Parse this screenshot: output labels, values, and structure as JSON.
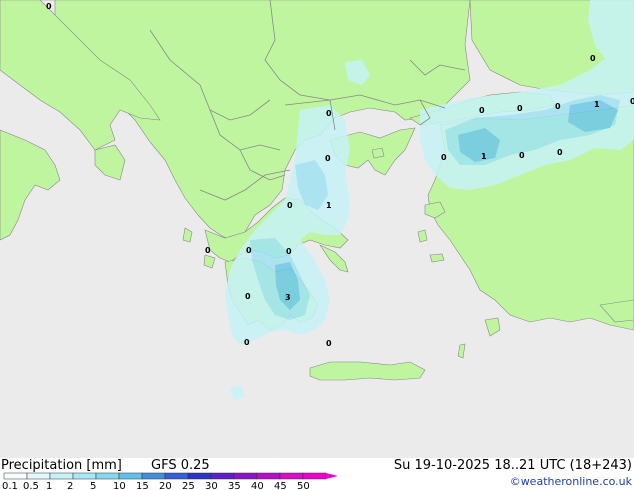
{
  "map": {
    "colors": {
      "sea": "#ebebeb",
      "land": "#c0f5a0",
      "border": "#888888",
      "precip_light": "#c6f3f7",
      "precip_mid": "#a0e3f2",
      "precip_heavy": "#6ec8e8"
    },
    "point_labels": [
      "0",
      "0",
      "0",
      "0",
      "0",
      "0",
      "0",
      "1",
      "0",
      "0",
      "1",
      "0",
      "1",
      "0",
      "0",
      "0",
      "0",
      "0",
      "3",
      "0",
      "0"
    ]
  },
  "footer": {
    "title": "Precipitation [mm]",
    "model": "GFS 0.25",
    "datetime": "Su 19-10-2025 18..21 UTC (18+243)",
    "credit": "©weatheronline.co.uk"
  },
  "legend": {
    "ticks": [
      "0.1",
      "0.5",
      "1",
      "2",
      "5",
      "10",
      "15",
      "20",
      "25",
      "30",
      "35",
      "40",
      "45",
      "50"
    ],
    "colors": [
      "#f5fdff",
      "#e2f8fb",
      "#c6f1f8",
      "#a8e7f5",
      "#86d8f1",
      "#5ec3ea",
      "#3f8fdc",
      "#3560d4",
      "#2a33c6",
      "#5e1ec8",
      "#8a14c8",
      "#b410c8",
      "#d80ec8",
      "#ee00d0"
    ]
  }
}
